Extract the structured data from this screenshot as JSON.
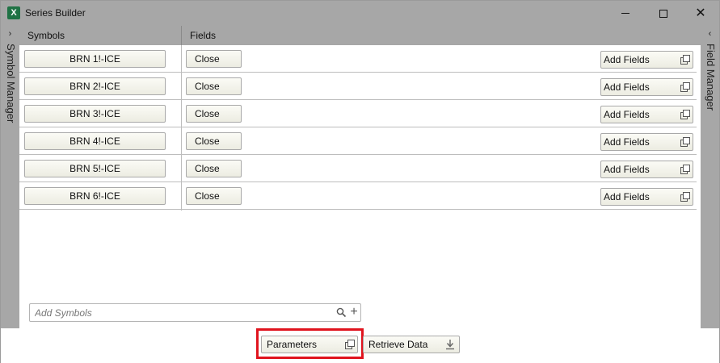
{
  "window": {
    "title": "Series Builder",
    "app_icon": "X"
  },
  "left_rail": {
    "label": "Symbol Manager",
    "chevron": "›"
  },
  "right_rail": {
    "label": "Field Manager",
    "chevron": "‹"
  },
  "headers": {
    "symbols": "Symbols",
    "fields": "Fields"
  },
  "rows": [
    {
      "symbol": "BRN 1!-ICE",
      "close": "Close",
      "add_fields": "Add Fields"
    },
    {
      "symbol": "BRN 2!-ICE",
      "close": "Close",
      "add_fields": "Add Fields"
    },
    {
      "symbol": "BRN 3!-ICE",
      "close": "Close",
      "add_fields": "Add Fields"
    },
    {
      "symbol": "BRN 4!-ICE",
      "close": "Close",
      "add_fields": "Add Fields"
    },
    {
      "symbol": "BRN 5!-ICE",
      "close": "Close",
      "add_fields": "Add Fields"
    },
    {
      "symbol": "BRN 6!-ICE",
      "close": "Close",
      "add_fields": "Add Fields"
    }
  ],
  "add_symbols": {
    "placeholder": "Add Symbols",
    "add_glyph": "+"
  },
  "footer": {
    "parameters_label": "Parameters",
    "retrieve_label": "Retrieve Data"
  },
  "colors": {
    "highlight": "#e0141e",
    "chrome": "#a7a7a7",
    "excel_green": "#1f7244"
  }
}
